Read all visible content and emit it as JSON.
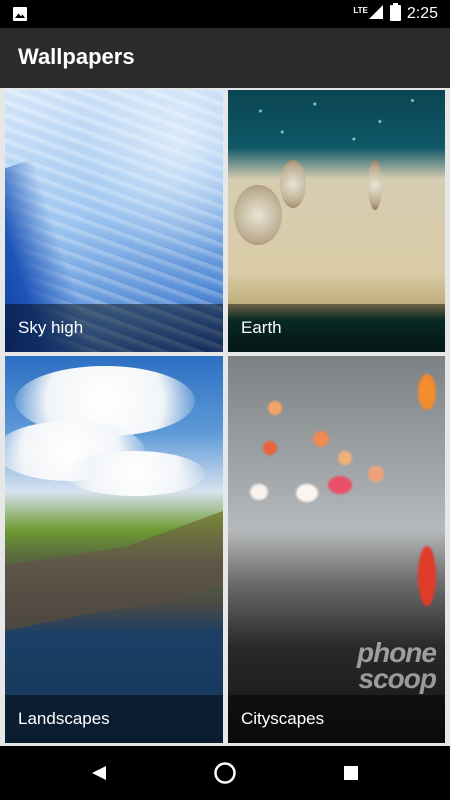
{
  "status_bar": {
    "time": "2:25",
    "network": "LTE",
    "left_icon": "image-icon"
  },
  "app_bar": {
    "title": "Wallpapers"
  },
  "tiles": [
    {
      "label": "Sky high"
    },
    {
      "label": "Earth"
    },
    {
      "label": "Landscapes"
    },
    {
      "label": "Cityscapes"
    }
  ],
  "nav": {
    "back": "back-icon",
    "home": "home-icon",
    "recents": "recents-icon"
  },
  "watermark": {
    "line1": "phone",
    "line2": "scoop"
  }
}
